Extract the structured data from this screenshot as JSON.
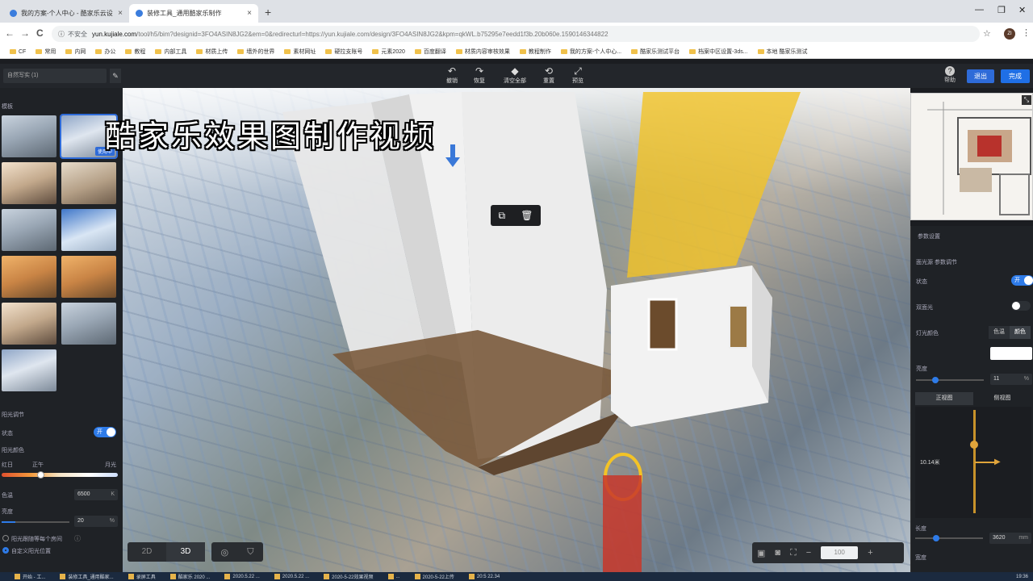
{
  "browser": {
    "tabs": [
      {
        "label": "我的方案-个人中心 - 酷家乐云设",
        "close": "×"
      },
      {
        "label": "装修工具_通用酷家乐制作",
        "close": "×"
      }
    ],
    "new_tab": "+",
    "window_controls": {
      "minimize": "—",
      "maximize": "❐",
      "close": "✕"
    },
    "nav": {
      "back": "←",
      "forward": "→",
      "reload": "C"
    },
    "security_label": "不安全",
    "url_host": "yun.kujiale.com",
    "url_path": "/tool/h5/bim?designid=3FO4ASIN8JG2&em=0&redirecturl=https://yun.kujiale.com/design/3FO4ASIN8JG2&kpm=qkWL.b75295e7eedd1f3b.20b060e.1590146344822",
    "bookmarks": [
      "CF",
      "常用",
      "内网",
      "办公",
      "教程",
      "内部工具",
      "材质上传",
      "墙外的世界",
      "素材网址",
      "硬拉支账号",
      "元素2020",
      "百度翻译",
      "材质内容审核效果",
      "教程制作",
      "我的方案-个人中心...",
      "酷家乐测试平台",
      "档案中区设置-3ds...",
      "本地 酷家乐测试"
    ]
  },
  "toolbar": {
    "mode_select": "自然写实 (1)",
    "edit_icon": "✎",
    "tools": [
      {
        "icon": "↶",
        "label": "撤销"
      },
      {
        "icon": "↷",
        "label": "恢复"
      },
      {
        "icon": "◆",
        "label": "清空全部"
      },
      {
        "icon": "⟲",
        "label": "重置"
      },
      {
        "icon": "⤢",
        "label": "预览"
      }
    ],
    "help_icon": "?",
    "help_label": "帮助",
    "exit_label": "退出",
    "done_label": "完成"
  },
  "left_panel": {
    "section_title": "模板",
    "in_use_badge": "使用中",
    "sun_title": "阳光调节",
    "state_label": "状态",
    "toggle_on": "开",
    "sun_color_label": "阳光颜色",
    "sun_ticks": [
      "红日",
      "正午",
      "月光"
    ],
    "color_temp_label": "色温",
    "color_temp_value": "6500",
    "color_temp_unit": "K",
    "brightness_label": "亮度",
    "brightness_value": "20",
    "brightness_unit": "%",
    "brightness_fraction": 0.2,
    "option_auto": "阳光跟随等每个房间",
    "option_custom": "自定义阳光位置"
  },
  "viewport": {
    "overlay_title": "酷家乐效果图制作视频",
    "ctx_copy_icon": "⧉",
    "ctx_delete_icon": "🗑",
    "view_2d": "2D",
    "view_3d": "3D",
    "zoom_minus": "−",
    "zoom_value": "100",
    "zoom_plus": "+"
  },
  "right_panel": {
    "title": "参数设置",
    "subtitle": "面光源 参数调节",
    "state_label": "状态",
    "toggle_on": "开",
    "double_side_label": "双面光",
    "light_color_label": "灯光颜色",
    "color_temp_tab": "色温",
    "color_tab": "颜色",
    "brightness_label": "亮度",
    "brightness_value": "11",
    "brightness_unit": "%",
    "view_front": "正视图",
    "view_side": "侧视图",
    "height_value": "10.14米",
    "length_label": "长度",
    "length_value": "3620",
    "length_unit": "mm",
    "width_label": "宽度"
  },
  "taskbar": {
    "items": [
      "开始 - 工...",
      "装修工具_通用酷家...",
      "录屏工具",
      "酷家乐 2020 ...",
      "2020.5.22 ...",
      "2020.5.22 ...",
      "2020-5-22效果视频",
      "...",
      "2020-5-22上传",
      "20:5 22.34"
    ],
    "clock": "19:36"
  },
  "colors": {
    "accent": "#1f6fe5",
    "panel_bg": "#1f2226",
    "highlight_yellow": "#f3c326"
  }
}
